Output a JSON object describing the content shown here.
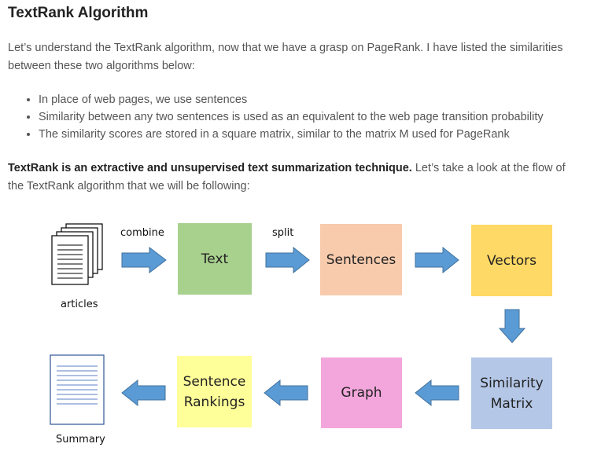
{
  "title": "TextRank Algorithm",
  "intro": "Let’s understand the TextRank algorithm, now that we have a grasp on PageRank. I have listed the similarities between these two algorithms below:",
  "bullets": [
    "In place of web pages, we use sentences",
    "Similarity between any two sentences is used as an equivalent to the web page transition probability",
    "The similarity scores are stored in a square matrix, similar to the matrix M used for PageRank"
  ],
  "summary_bold": "TextRank is an extractive and unsupervised text summarization technique.",
  "summary_rest": " Let’s take a look at the flow of the TextRank algorithm that we will be following:",
  "flow": {
    "articles_label": "articles",
    "combine_label": "combine",
    "split_label": "split",
    "summary_label": "Summary",
    "text": "Text",
    "sentences": "Sentences",
    "vectors": "Vectors",
    "similarity_line1": "Similarity",
    "similarity_line2": "Matrix",
    "graph": "Graph",
    "rankings_line1": "Sentence",
    "rankings_line2": "Rankings",
    "colors": {
      "text": "#a9d18e",
      "sentences": "#f8cbad",
      "vectors": "#ffd966",
      "similarity": "#b4c7e7",
      "graph": "#f2a6dc",
      "rankings": "#ffff99",
      "arrow": "#5b9bd5"
    }
  }
}
